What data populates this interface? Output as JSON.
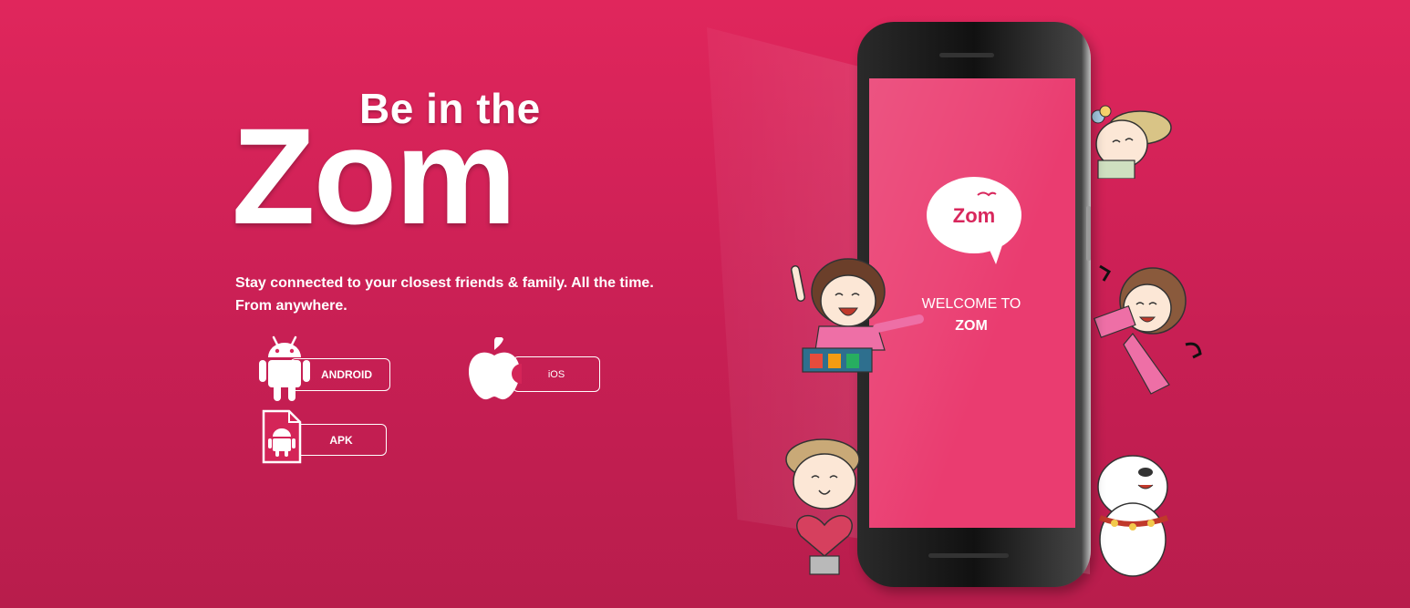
{
  "hero": {
    "headline_small": "Be in the",
    "headline_big": "Zom",
    "subtitle_line1": "Stay connected to your closest friends & family. All the time.",
    "subtitle_line2": "From anywhere."
  },
  "downloads": {
    "android_label": "ANDROID",
    "ios_label": "iOS",
    "apk_label": "APK"
  },
  "phone": {
    "logo_text": "Zom",
    "welcome_line1": "WELCOME TO",
    "welcome_line2": "ZOM"
  },
  "colors": {
    "background": "#e0265c",
    "screen": "#ea3c70",
    "logo_text": "#d8275c"
  },
  "icons": [
    "android-robot-icon",
    "apple-logo-icon",
    "apk-file-icon",
    "zom-speech-bubble-logo"
  ]
}
